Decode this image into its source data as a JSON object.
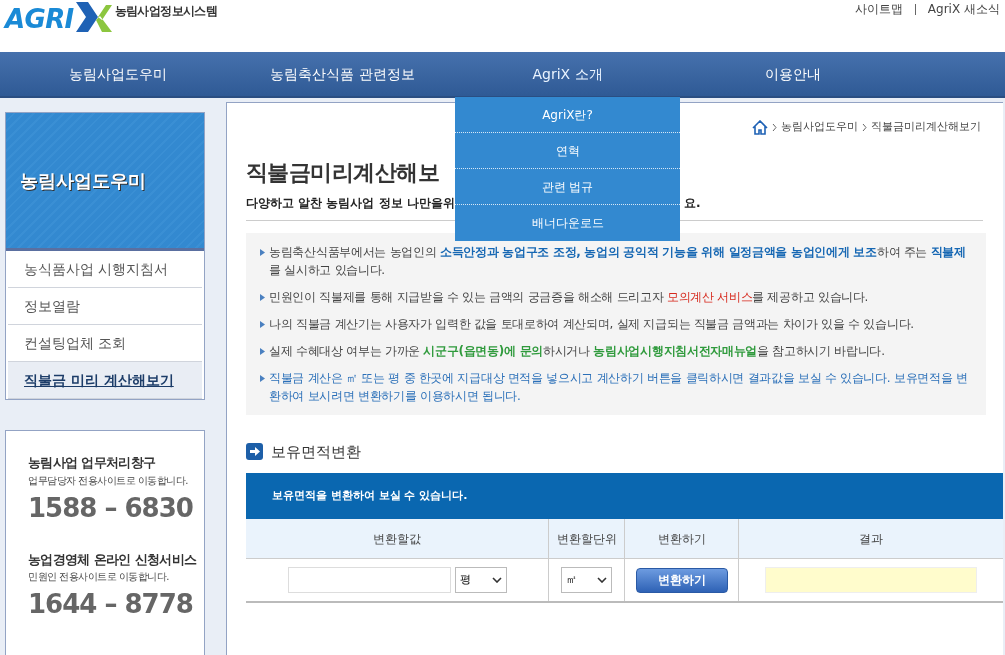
{
  "header": {
    "logo": {
      "wordmark": "AGRI",
      "tagline": "농림사업정보시스템"
    },
    "links": [
      "사이트맵",
      "AgriX 새소식"
    ]
  },
  "nav": [
    {
      "label": "농림사업도우미",
      "expanded": false
    },
    {
      "label": "농림축산식품 관련정보",
      "expanded": false
    },
    {
      "label": "AgriX 소개",
      "expanded": true,
      "submenu": [
        "AgriX란?",
        "연혁",
        "관련 법규",
        "배너다운로드"
      ]
    },
    {
      "label": "이용안내",
      "expanded": false
    }
  ],
  "sidebar": {
    "title": "농림사업도우미",
    "items": [
      {
        "label": "농식품사업 시행지침서",
        "selected": false
      },
      {
        "label": "정보열람",
        "selected": false
      },
      {
        "label": "컨설팅업체 조회",
        "selected": false
      },
      {
        "label": "직불금 미리 계산해보기",
        "selected": true
      }
    ],
    "contacts": [
      {
        "title": "농림사업 업무처리창구",
        "subtitle": "업무담당자 전용사이트로 이동합니다.",
        "phone": "1588 – 6830"
      },
      {
        "title": "농업경영체 온라인 신청서비스",
        "subtitle": "민원인 전용사이트로 이동합니다.",
        "phone": "1644 – 8778"
      }
    ]
  },
  "breadcrumb": [
    "농림사업도우미",
    "직불금미리계산해보기"
  ],
  "page": {
    "title": "직불금미리계산해보",
    "subtitle_start": "다양하고 알찬 농림사업 정보 나만을위",
    "subtitle_end": "요."
  },
  "notes": [
    [
      {
        "kind": "plain",
        "text": "농림축산식품부에서는 농업인의 "
      },
      {
        "kind": "blue",
        "text": "소득안정과 농업구조 조정, 농업의 공익적 기능을 위해 일정금액을 농업인에게 보조"
      },
      {
        "kind": "plain",
        "text": "하여 주는 "
      },
      {
        "kind": "blue",
        "text": "직불제"
      },
      {
        "kind": "plain",
        "text": "를 실시하고 있습니다."
      }
    ],
    [
      {
        "kind": "plain",
        "text": "민원인이 직불제를 통해 지급받을 수 있는 금액의 궁금증을 해소해 드리고자 "
      },
      {
        "kind": "red",
        "text": "모의계산 서비스"
      },
      {
        "kind": "plain",
        "text": "를 제공하고 있습니다."
      }
    ],
    [
      {
        "kind": "plain",
        "text": "나의 직불금 계산기는 사용자가 입력한 값을 토대로하여 계산되며, 실제 지급되는 직불금 금액과는 차이가 있을 수 있습니다."
      }
    ],
    [
      {
        "kind": "plain",
        "text": "실제 수혜대상 여부는 가까운 "
      },
      {
        "kind": "green",
        "text": "시군구(읍면동)에 문의"
      },
      {
        "kind": "plain",
        "text": "하시거나 "
      },
      {
        "kind": "green",
        "text": "농림사업시행지침서전자매뉴얼"
      },
      {
        "kind": "plain",
        "text": "을 참고하시기 바랍니다."
      }
    ],
    [
      {
        "kind": "link",
        "text": "직불금 계산은 ㎡ 또는 평 중 한곳에 지급대상 면적을 넣으시고 계산하기 버튼을 클릭하시면 결과값을 보실 수 있습니다. 보유면적을 변환하여 보시려면 변환하기를 이용하시면 됩니다."
      }
    ]
  ],
  "converter": {
    "title": "보유면적변환",
    "banner": "보유면적을 변환하여 보실 수 있습니다.",
    "columns": [
      "변환할값",
      "변환할단위",
      "변환하기",
      "결과"
    ],
    "from_unit": "평",
    "to_unit": "㎡",
    "button": "변환하기"
  }
}
